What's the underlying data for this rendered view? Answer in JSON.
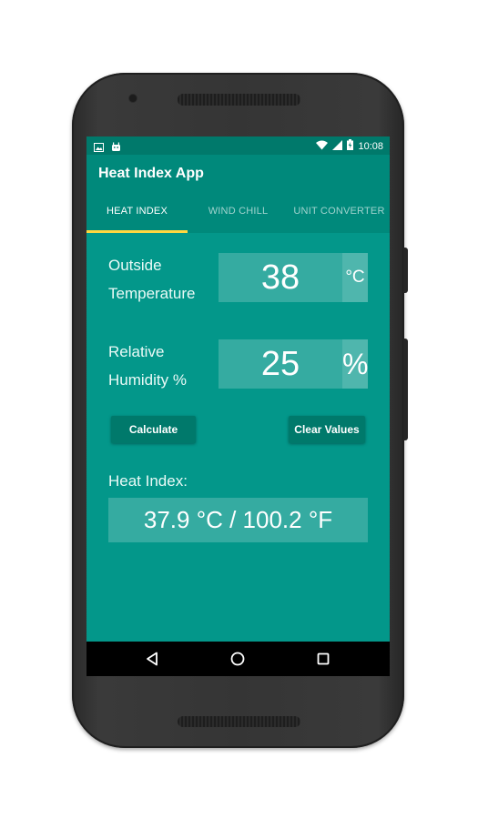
{
  "statusbar": {
    "time": "10:08",
    "icons": [
      "image-icon",
      "android-icon",
      "wifi-icon",
      "signal-icon",
      "battery-charging-icon"
    ]
  },
  "app": {
    "title": "Heat Index App"
  },
  "tabs": [
    {
      "label": "HEAT INDEX",
      "active": true
    },
    {
      "label": "WIND CHILL",
      "active": false
    },
    {
      "label": "UNIT CONVERTER",
      "active": false
    }
  ],
  "form": {
    "temperature": {
      "label_line1": "Outside",
      "label_line2": "Temperature",
      "value": "38",
      "unit": "°C"
    },
    "humidity": {
      "label_line1": "Relative",
      "label_line2": "Humidity %",
      "value": "25",
      "unit": "%"
    }
  },
  "buttons": {
    "calculate": "Calculate",
    "clear": "Clear Values"
  },
  "result": {
    "label": "Heat Index:",
    "value": "37.9 °C / 100.2 °F"
  },
  "navbar": {
    "icons": [
      "back-icon",
      "home-icon",
      "recents-icon"
    ]
  },
  "colors": {
    "primary": "#00897b",
    "primary_dark": "#00796b",
    "background": "#03978a",
    "accent": "#ffd740"
  }
}
